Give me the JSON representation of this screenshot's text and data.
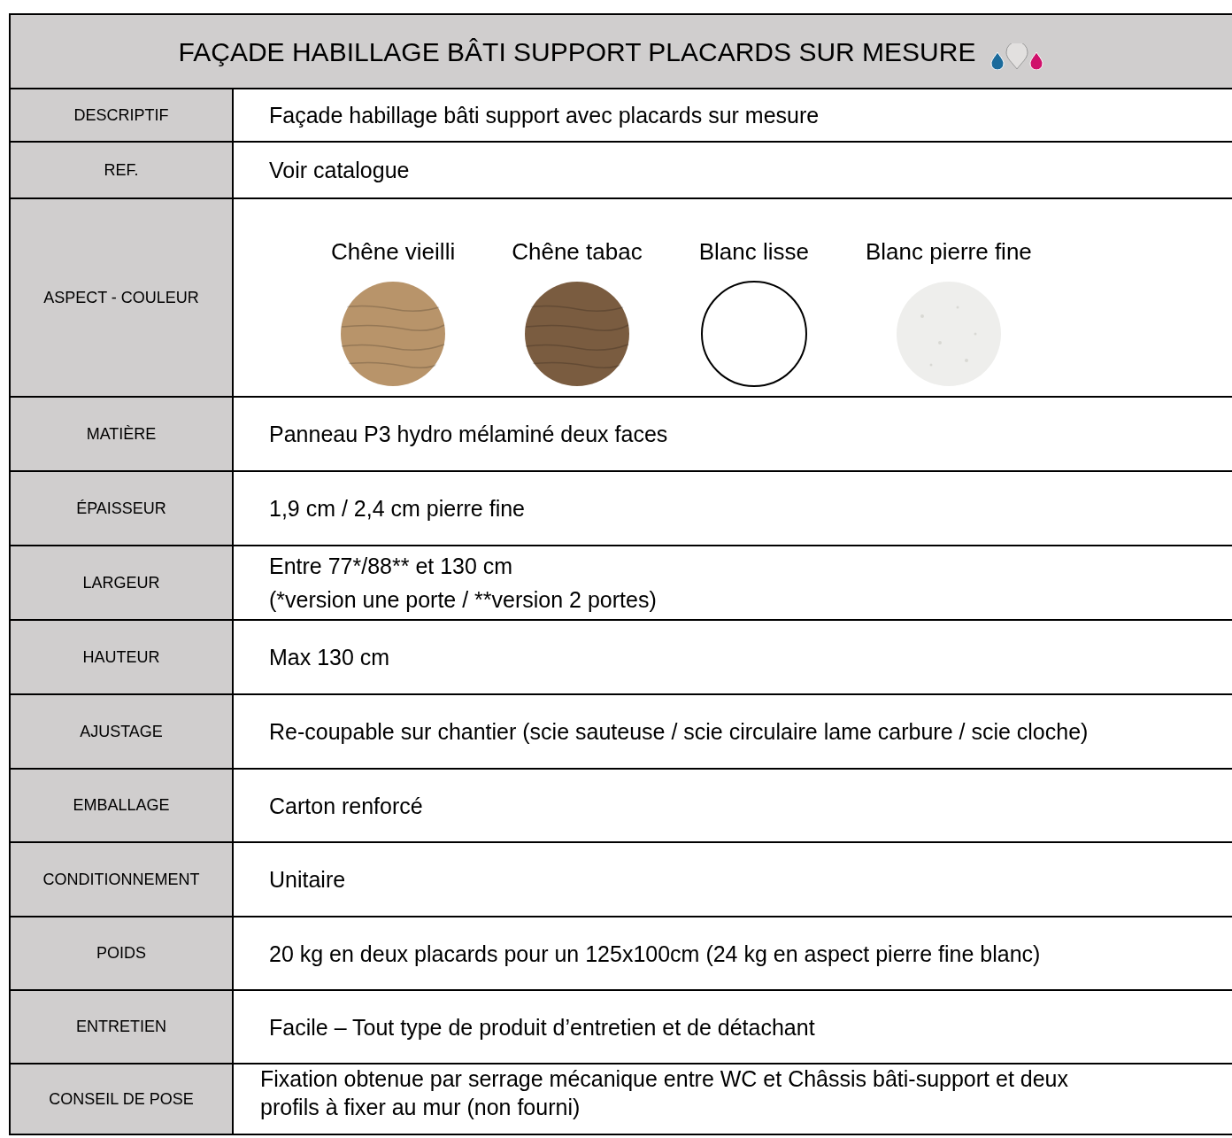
{
  "title": "FAÇADE HABILLAGE BÂTI SUPPORT PLACARDS SUR MESURE",
  "rows": [
    {
      "kind": "text",
      "label": "DESCRIPTIF",
      "lines": [
        "Façade habillage bâti support avec placards sur mesure"
      ]
    },
    {
      "kind": "text",
      "label": "REF.",
      "lines": [
        "Voir catalogue"
      ]
    },
    {
      "kind": "swatches",
      "label": "ASPECT - COULEUR",
      "swatches": [
        {
          "name": "Chêne vieilli",
          "kind": "wood",
          "color": "#b8946a"
        },
        {
          "name": "Chêne tabac",
          "kind": "wood",
          "color": "#7a5c40"
        },
        {
          "name": "Blanc lisse",
          "kind": "plain",
          "color": "#ffffff"
        },
        {
          "name": "Blanc pierre fine",
          "kind": "stone",
          "color": "#eeeeec"
        }
      ]
    },
    {
      "kind": "text",
      "label": "MATIÈRE",
      "lines": [
        "Panneau P3 hydro mélaminé deux faces"
      ]
    },
    {
      "kind": "text",
      "label": "ÉPAISSEUR",
      "lines": [
        "1,9 cm / 2,4 cm pierre fine"
      ]
    },
    {
      "kind": "text",
      "label": "LARGEUR",
      "lines": [
        "Entre 77*/88** et 130 cm",
        "(*version une porte / **version 2 portes)"
      ]
    },
    {
      "kind": "text",
      "label": "HAUTEUR",
      "lines": [
        "Max 130 cm"
      ]
    },
    {
      "kind": "text",
      "label": "AJUSTAGE",
      "lines": [
        "Re-coupable  sur chantier (scie sauteuse / scie circulaire lame carbure / scie cloche)"
      ]
    },
    {
      "kind": "text",
      "label": "EMBALLAGE",
      "lines": [
        "Carton renforcé"
      ]
    },
    {
      "kind": "text",
      "label": "CONDITIONNEMENT",
      "lines": [
        "Unitaire"
      ]
    },
    {
      "kind": "text",
      "label": "POIDS",
      "lines": [
        "20 kg en deux placards pour un 125x100cm (24 kg en aspect pierre fine blanc)"
      ]
    },
    {
      "kind": "text",
      "label": "ENTRETIEN",
      "lines": [
        "Facile – Tout type de produit d’entretien et de détachant"
      ]
    },
    {
      "kind": "text",
      "label": "CONSEIL DE POSE",
      "lines": [
        "Fixation obtenue par serrage mécanique entre WC et Châssis bâti-support et deux",
        "profils à fixer au mur (non fourni)"
      ]
    }
  ]
}
